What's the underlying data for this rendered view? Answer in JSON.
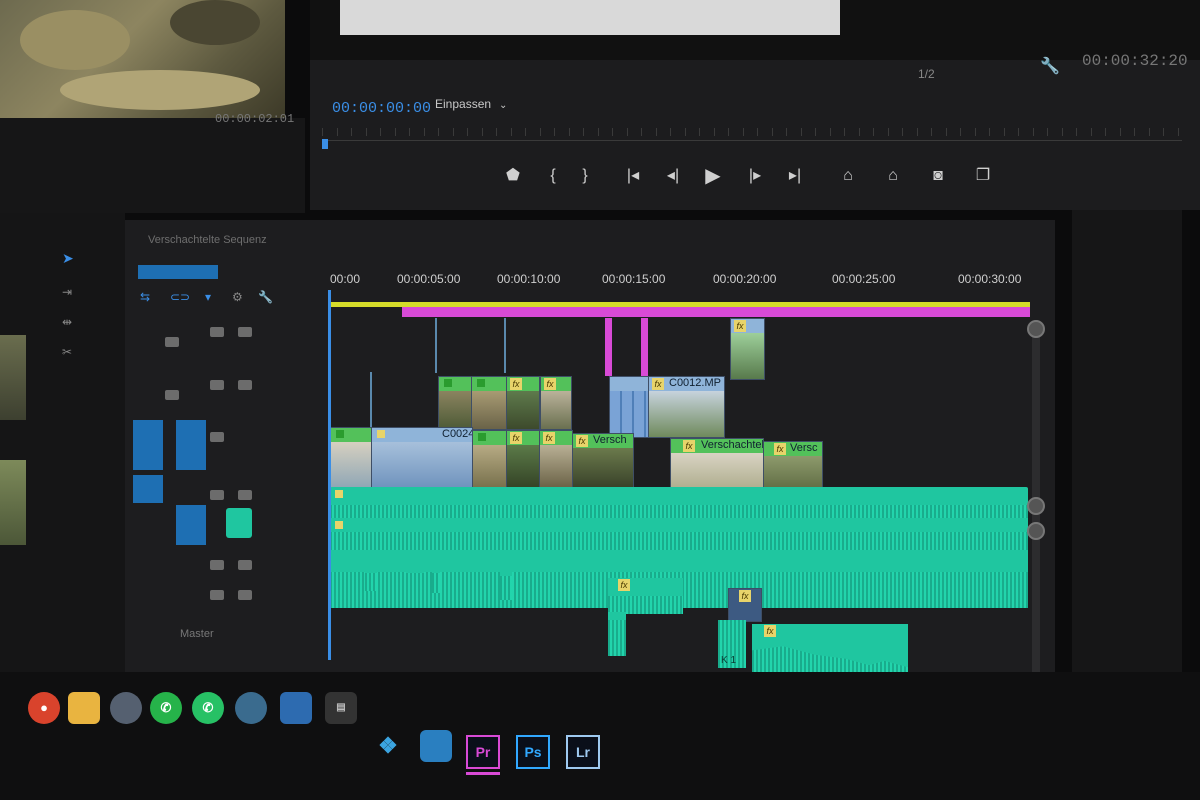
{
  "program_monitor": {
    "timecode": "00:00:00:00",
    "fit_label": "Einpassen",
    "resolution": "1/2",
    "duration": "00:00:32:20"
  },
  "source_monitor": {
    "timecode": "00:00:02:01"
  },
  "timeline": {
    "sequence_name": "Verschachtelte Sequenz",
    "ruler": [
      "00:00",
      "00:00:05:00",
      "00:00:10:00",
      "00:00:15:00",
      "00:00:20:00",
      "00:00:25:00",
      "00:00:30:00"
    ],
    "clips": {
      "c0024": "C0024",
      "c0012": "C0012.MP",
      "versch1": "Versch",
      "versch2": "Verschachtelt",
      "versch3": "Versc"
    },
    "audio_labels": [
      "K 1",
      "K 1"
    ],
    "track_label": "Master"
  },
  "taskbar": {
    "apps": [
      "Pr",
      "Ps",
      "Lr"
    ]
  },
  "colors": {
    "accent_blue": "#3a8ee6",
    "work_area": "#d5dc2a",
    "render_bar": "#d84ad6",
    "audio_clip": "#1fc6a0",
    "video_clip": "#8fb4d9",
    "nested_clip": "#53c15a"
  }
}
